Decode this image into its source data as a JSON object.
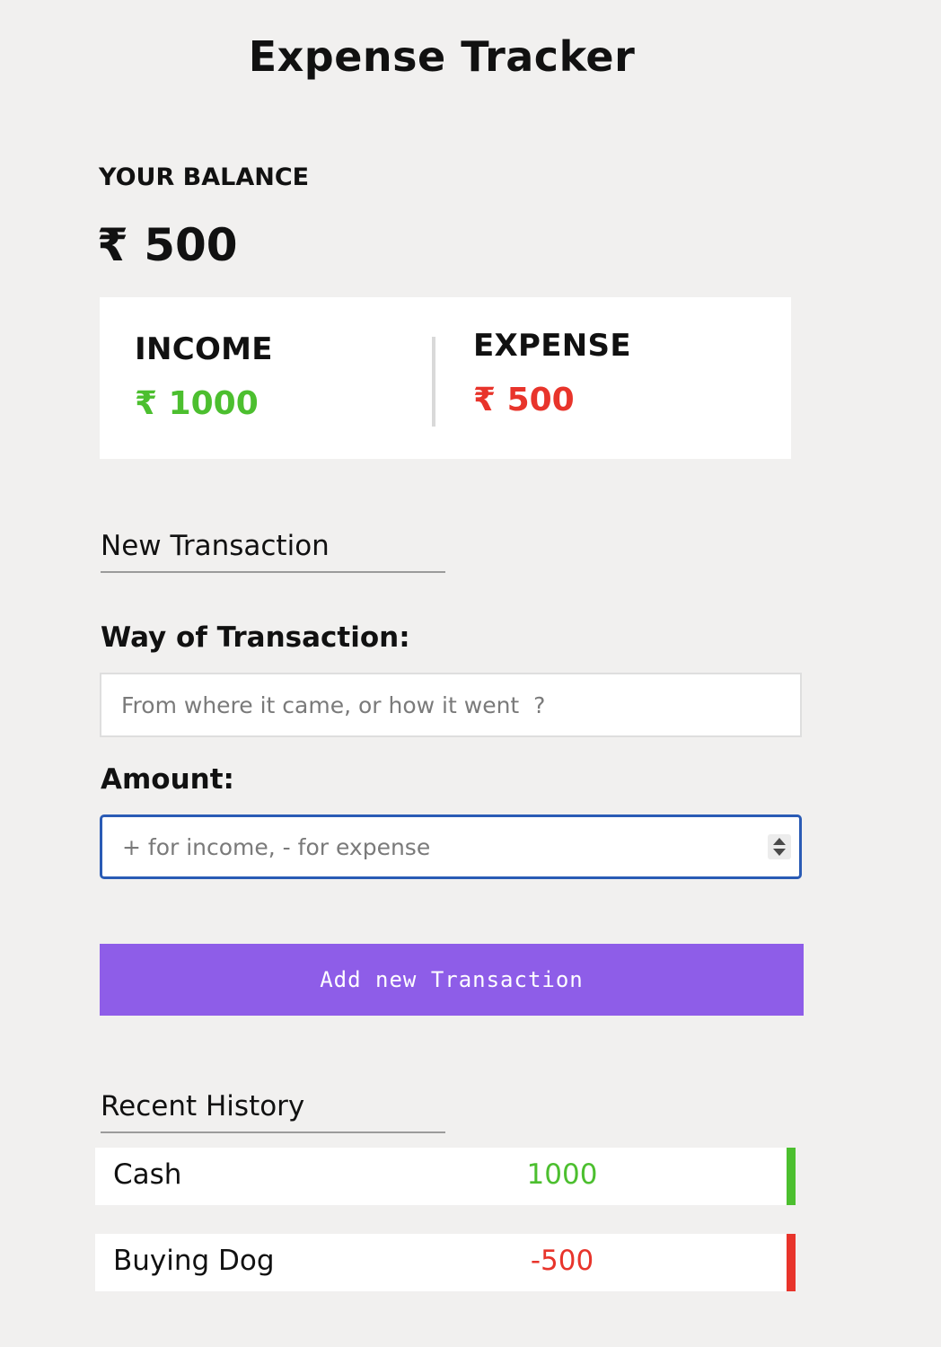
{
  "app": {
    "title": "Expense Tracker"
  },
  "balance": {
    "label": "YOUR BALANCE",
    "value": "₹ 500"
  },
  "summary": {
    "income_label": "INCOME",
    "income_value": "₹ 1000",
    "expense_label": "EXPENSE",
    "expense_value": "₹ 500",
    "colors": {
      "income": "#4cbf2f",
      "expense": "#e8342b"
    }
  },
  "new_transaction": {
    "heading": "New Transaction",
    "way_label": "Way of Transaction:",
    "way_value": "",
    "way_placeholder": "From where it came, or how it went  ?",
    "amount_label": "Amount:",
    "amount_value": "",
    "amount_placeholder": "+ for income, - for expense",
    "submit_label": "Add new Transaction",
    "button_color": "#8e5de8"
  },
  "history": {
    "heading": "Recent History",
    "items": [
      {
        "name": "Cash",
        "amount": "1000",
        "type": "income"
      },
      {
        "name": "Buying Dog",
        "amount": "-500",
        "type": "expense"
      }
    ]
  }
}
